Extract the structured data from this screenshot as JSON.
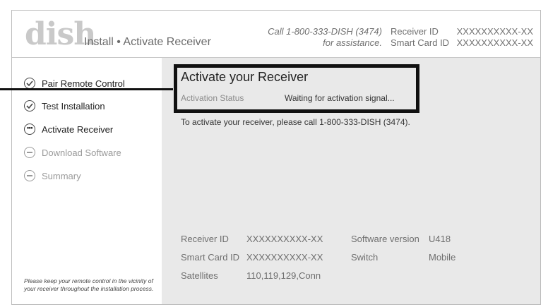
{
  "header": {
    "logo": "dish",
    "title": "Install • Activate Receiver",
    "assist_line1": "Call 1-800-333-DISH (3474)",
    "assist_line2": "for assistance.",
    "receiver_id_label": "Receiver ID",
    "receiver_id_value": "XXXXXXXXXX-XX",
    "smart_card_label": "Smart Card ID",
    "smart_card_value": "XXXXXXXXXX-XX"
  },
  "sidebar": {
    "steps": [
      {
        "label": "Pair Remote Control",
        "state": "done",
        "icon": "check-circle-icon"
      },
      {
        "label": "Test Installation",
        "state": "done",
        "icon": "check-circle-icon"
      },
      {
        "label": "Activate Receiver",
        "state": "active",
        "icon": "ellipsis-circle-icon"
      },
      {
        "label": "Download Software",
        "state": "pending",
        "icon": "dash-circle-icon"
      },
      {
        "label": "Summary",
        "state": "pending",
        "icon": "dash-circle-icon"
      }
    ],
    "note": "Please keep your remote control in the vicinity of your receiver throughout the installation process."
  },
  "main": {
    "title": "Activate your Receiver",
    "status_label": "Activation Status",
    "status_value": "Waiting for activation signal...",
    "instructions": "To activate your receiver, please call 1-800-333-DISH (3474).",
    "info": {
      "receiver_id_label": "Receiver ID",
      "receiver_id_value": "XXXXXXXXXX-XX",
      "smart_card_label": "Smart Card ID",
      "smart_card_value": "XXXXXXXXXX-XX",
      "satellites_label": "Satellites",
      "satellites_value": "110,119,129,Conn",
      "software_label": "Software version",
      "software_value": "U418",
      "switch_label": "Switch",
      "switch_value": "Mobile"
    }
  },
  "colors": {
    "panel_bg": "#e9e9e9",
    "callout_border": "#111111",
    "logo_color": "#c9c9c9"
  }
}
